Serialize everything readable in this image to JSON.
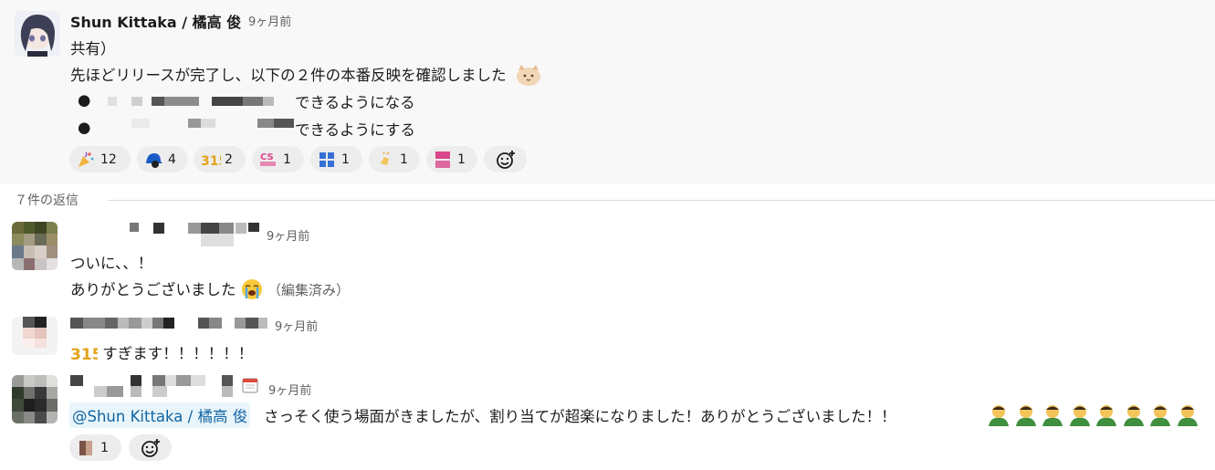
{
  "parent": {
    "author": "Shun Kittaka / 橘高 俊",
    "time": "9ヶ月前",
    "line1": "共有）",
    "line2": "先ほどリリースが完了し、以下の２件の本番反映を確認しました",
    "bullet1": "できるようになる",
    "bullet2": "できるようにする",
    "reactions": [
      {
        "icon": "party-popper-icon",
        "count": "12"
      },
      {
        "icon": "blue-cap-icon",
        "count": "4"
      },
      {
        "icon": "3150-sticker-icon",
        "count": "2"
      },
      {
        "icon": "cs-sticker-icon",
        "count": "1"
      },
      {
        "icon": "crying-sticker-icon",
        "count": "1"
      },
      {
        "icon": "clapping-icon",
        "count": "1"
      },
      {
        "icon": "kitsuhiko-sticker-icon",
        "count": "1"
      }
    ]
  },
  "thread": {
    "reply_count": "７件の返信"
  },
  "reply1": {
    "time": "9ヶ月前",
    "line1": "ついに、、！",
    "line2": "ありがとうございました",
    "edited": "（編集済み）"
  },
  "reply2": {
    "time": "9ヶ月前",
    "text": "すぎます！！！！！！"
  },
  "reply3": {
    "time": "9ヶ月前",
    "mention": "@Shun Kittaka / 橘高 俊",
    "text": "さっそく使う場面がきましたが、割り当てが超楽になりました！ありがとうございました！！",
    "reaction_count": "1"
  },
  "colors": {
    "link": "#1264a3",
    "mention_bg": "#e8f5fa",
    "reaction_bg": "#ededed"
  }
}
